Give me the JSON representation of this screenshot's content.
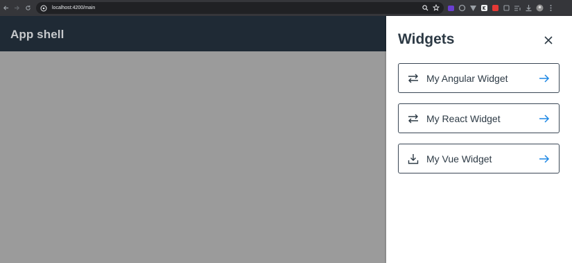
{
  "browser": {
    "url": "localhost:4200/main"
  },
  "app": {
    "title": "App shell"
  },
  "drawer": {
    "title": "Widgets",
    "widgets": [
      {
        "label": "My Angular Widget",
        "icon": "swap-arrows-icon"
      },
      {
        "label": "My React Widget",
        "icon": "swap-arrows-icon"
      },
      {
        "label": "My Vue Widget",
        "icon": "download-icon"
      }
    ]
  },
  "colors": {
    "header": "#1f2a35",
    "backdrop": "#9b9b9b",
    "accent": "#1e88e5",
    "text": "#2d3a45"
  }
}
